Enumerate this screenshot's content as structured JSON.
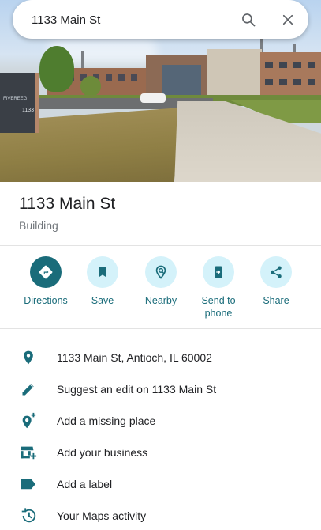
{
  "search": {
    "value": "1133 Main St",
    "search_icon": "search-icon",
    "close_icon": "close-icon"
  },
  "sign_text": [
    "FIVEREEG",
    "1133"
  ],
  "place": {
    "title": "1133 Main St",
    "category": "Building"
  },
  "actions": [
    {
      "label": "Directions",
      "icon": "directions-icon"
    },
    {
      "label": "Save",
      "icon": "bookmark-icon"
    },
    {
      "label": "Nearby",
      "icon": "nearby-icon"
    },
    {
      "label": "Send to phone",
      "label_line1": "Send to",
      "label_line2": "phone",
      "icon": "send-to-phone-icon"
    },
    {
      "label": "Share",
      "icon": "share-icon"
    }
  ],
  "details": [
    {
      "text": "1133 Main St, Antioch, IL 60002",
      "icon": "location-pin-icon"
    },
    {
      "text": "Suggest an edit on 1133 Main St",
      "icon": "pencil-icon"
    },
    {
      "text": "Add a missing place",
      "icon": "add-place-icon"
    },
    {
      "text": "Add your business",
      "icon": "add-business-icon"
    },
    {
      "text": "Add a label",
      "icon": "label-icon"
    },
    {
      "text": "Your Maps activity",
      "icon": "history-icon"
    }
  ],
  "colors": {
    "accent": "#1a6c7a",
    "accent_light": "#d4f2fa",
    "text": "#202124",
    "subtext": "#70757a"
  }
}
